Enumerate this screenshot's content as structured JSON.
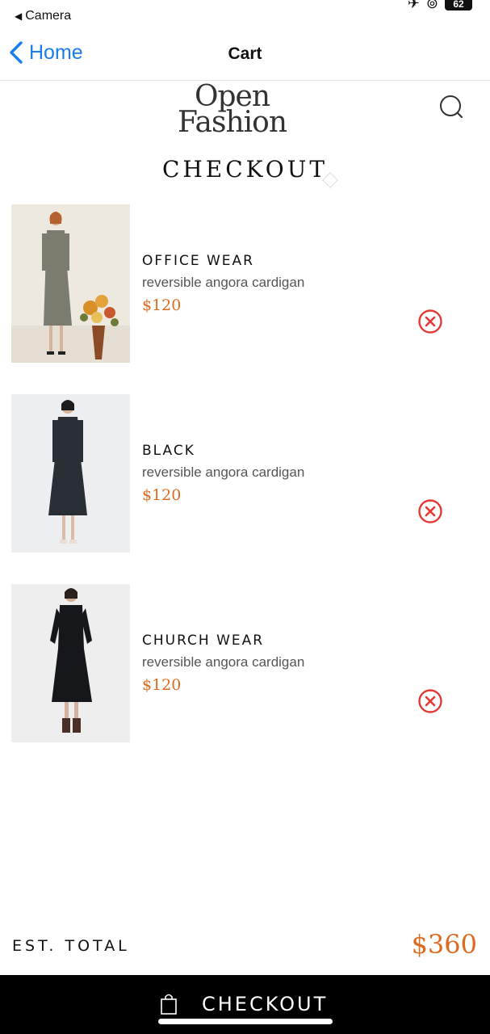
{
  "status_bar": {
    "back_app": "Camera",
    "battery": "62"
  },
  "nav": {
    "back_label": "Home",
    "title": "Cart"
  },
  "brand": {
    "logo_line1": "Open",
    "logo_line2": "Fashion"
  },
  "page": {
    "heading": "CHECKOUT"
  },
  "cart": {
    "items": [
      {
        "title": "OFFICE WEAR",
        "description": "reversible angora cardigan",
        "price": "$120"
      },
      {
        "title": "BLACK",
        "description": "reversible angora cardigan",
        "price": "$120"
      },
      {
        "title": "CHURCH WEAR",
        "description": "reversible angora cardigan",
        "price": "$120"
      }
    ]
  },
  "summary": {
    "total_label": "EST. TOTAL",
    "total_value": "$360"
  },
  "checkout": {
    "label": "CHECKOUT"
  },
  "colors": {
    "accent_price": "#dd6a1f",
    "link_blue": "#1a7cf0",
    "remove_red": "#e53935",
    "bar_black": "#000000"
  },
  "icons": {
    "back": "chevron-left-icon",
    "search": "search-icon",
    "remove": "remove-circle-x-icon",
    "bag": "shopping-bag-icon"
  }
}
